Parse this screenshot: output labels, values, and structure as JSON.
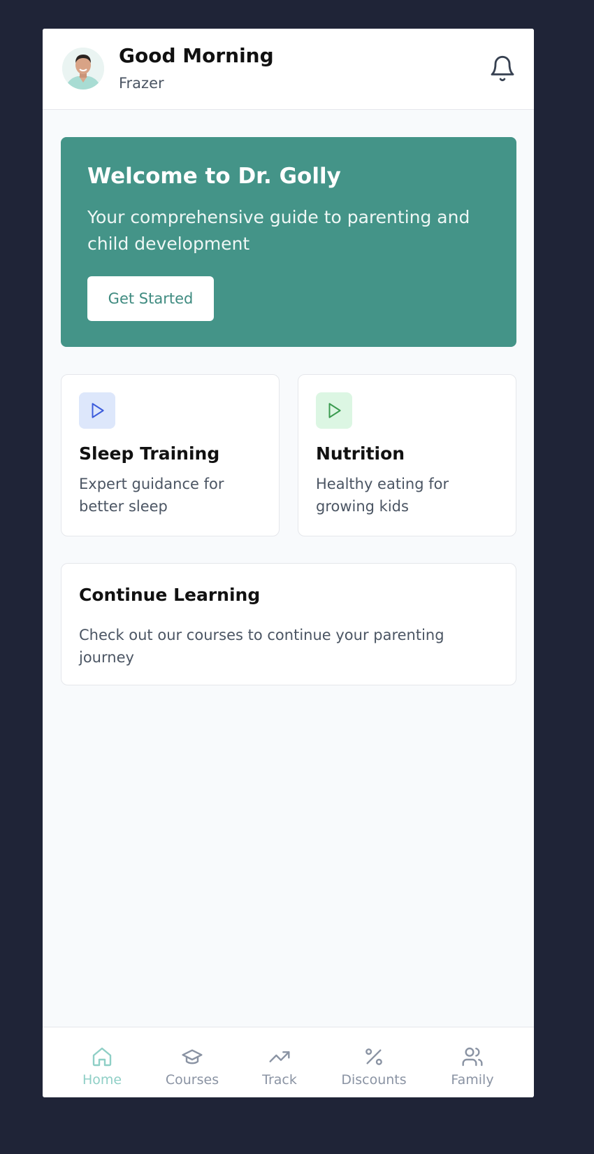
{
  "header": {
    "greeting": "Good Morning",
    "username": "Frazer",
    "notification_icon": "bell-icon"
  },
  "hero": {
    "title": "Welcome to Dr. Golly",
    "subtitle": "Your comprehensive guide to parenting and child development",
    "button_label": "Get Started"
  },
  "topics": [
    {
      "title": "Sleep Training",
      "description": "Expert guidance for better sleep",
      "icon": "play-icon",
      "accent": "#3b5bdb"
    },
    {
      "title": "Nutrition",
      "description": "Healthy eating for growing kids",
      "icon": "play-icon",
      "accent": "#3a9a4f"
    }
  ],
  "continue_learning": {
    "title": "Continue Learning",
    "description": "Check out our courses to continue your parenting journey"
  },
  "nav": {
    "items": [
      {
        "label": "Home",
        "icon": "home-icon",
        "active": true
      },
      {
        "label": "Courses",
        "icon": "graduation-cap-icon",
        "active": false
      },
      {
        "label": "Track",
        "icon": "trending-up-icon",
        "active": false
      },
      {
        "label": "Discounts",
        "icon": "percent-icon",
        "active": false
      },
      {
        "label": "Family",
        "icon": "users-icon",
        "active": false
      }
    ]
  },
  "colors": {
    "brand": "#449488",
    "nav_active": "#8fcfc6",
    "nav_inactive": "#8a93a3"
  }
}
